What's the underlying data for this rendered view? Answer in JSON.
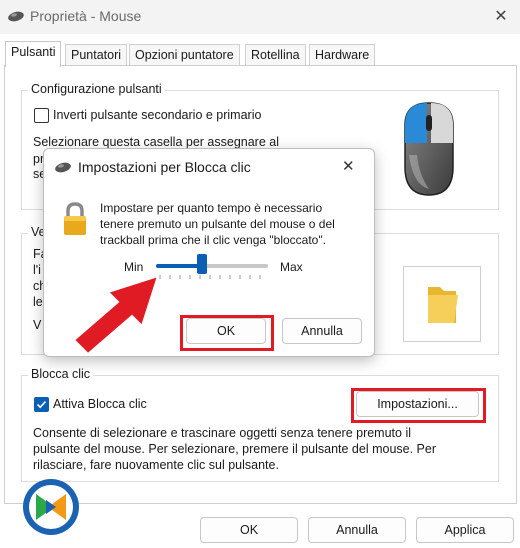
{
  "window": {
    "title": "Proprietà - Mouse"
  },
  "tabs": [
    {
      "label": "Pulsanti"
    },
    {
      "label": "Puntatori"
    },
    {
      "label": "Opzioni puntatore"
    },
    {
      "label": "Rotellina"
    },
    {
      "label": "Hardware"
    }
  ],
  "button_config": {
    "group_label": "Configurazione pulsanti",
    "swap_label": "Inverti pulsante secondario e primario",
    "swap_checked": false,
    "desc_line1": "Selezionare questa casella per assegnare al",
    "desc_frag1": "pr",
    "desc_frag2": "se"
  },
  "doubleclick": {
    "group_label_frag": "Ve",
    "frag1": "Fa",
    "frag2": "l'i",
    "frag3": "ch",
    "frag4": "le",
    "frag5": "V"
  },
  "clicklock": {
    "group_label": "Blocca clic",
    "enable_label": "Attiva Blocca clic",
    "enable_checked": true,
    "settings_button": "Impostazioni...",
    "description": [
      "Consente di selezionare e trascinare oggetti senza tenere premuto il",
      "pulsante del mouse. Per selezionare, premere il pulsante del mouse. Per",
      "rilasciare, fare nuovamente clic sul pulsante."
    ]
  },
  "footer": {
    "ok": "OK",
    "cancel": "Annulla",
    "apply": "Applica"
  },
  "dialog": {
    "title": "Impostazioni per Blocca clic",
    "message": [
      "Impostare per quanto tempo è necessario",
      "tenere premuto un pulsante del mouse o del",
      "trackball prima che il clic venga \"bloccato\"."
    ],
    "slider_min": "Min",
    "slider_max": "Max",
    "slider_value": 0.4,
    "ok": "OK",
    "cancel": "Annulla"
  },
  "colors": {
    "highlight": "#e01b24",
    "accent": "#0a5fb4"
  }
}
